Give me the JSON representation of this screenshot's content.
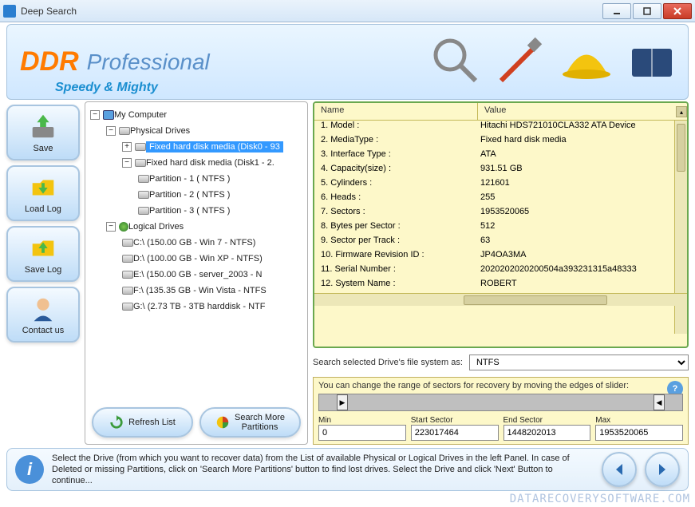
{
  "window": {
    "title": "Deep Search"
  },
  "banner": {
    "brand": "DDR",
    "suffix": "Professional",
    "tagline": "Speedy & Mighty"
  },
  "sidebar": [
    {
      "label": "Save"
    },
    {
      "label": "Load Log"
    },
    {
      "label": "Save Log"
    },
    {
      "label": "Contact us"
    }
  ],
  "tree": {
    "root": "My Computer",
    "physical": "Physical Drives",
    "disk0": "Fixed hard disk media (Disk0 - 93",
    "disk1": "Fixed hard disk media (Disk1 - 2.",
    "part1": "Partition - 1 ( NTFS )",
    "part2": "Partition - 2 ( NTFS )",
    "part3": "Partition - 3 ( NTFS )",
    "logical": "Logical Drives",
    "c": "C:\\ (150.00 GB - Win 7 - NTFS)",
    "d": "D:\\ (100.00 GB - Win XP - NTFS)",
    "e": "E:\\ (150.00 GB - server_2003 - N",
    "f": "F:\\ (135.35 GB - Win Vista - NTFS",
    "g": "G:\\ (2.73 TB - 3TB harddisk - NTF"
  },
  "tree_buttons": {
    "refresh": "Refresh List",
    "more": "Search More\nPartitions"
  },
  "props": {
    "header_name": "Name",
    "header_value": "Value",
    "rows": [
      {
        "name": "1. Model :",
        "value": "Hitachi HDS721010CLA332 ATA Device"
      },
      {
        "name": "2. MediaType :",
        "value": "Fixed hard disk media"
      },
      {
        "name": "3. Interface Type :",
        "value": "ATA"
      },
      {
        "name": "4. Capacity(size) :",
        "value": "931.51 GB"
      },
      {
        "name": "5. Cylinders :",
        "value": "121601"
      },
      {
        "name": "6. Heads :",
        "value": "255"
      },
      {
        "name": "7. Sectors :",
        "value": "1953520065"
      },
      {
        "name": "8. Bytes per Sector :",
        "value": "512"
      },
      {
        "name": "9. Sector per Track :",
        "value": "63"
      },
      {
        "name": "10. Firmware Revision ID :",
        "value": "JP4OA3MA"
      },
      {
        "name": "11. Serial Number :",
        "value": "2020202020200504a393231315a48333"
      },
      {
        "name": "12. System Name :",
        "value": "ROBERT"
      }
    ]
  },
  "search": {
    "label": "Search selected Drive's file system as:",
    "value": "NTFS"
  },
  "slider": {
    "msg": "You can change the range of sectors for recovery by moving the edges of slider:",
    "min_label": "Min",
    "start_label": "Start Sector",
    "end_label": "End Sector",
    "max_label": "Max",
    "min": "0",
    "start": "223017464",
    "end": "1448202013",
    "max": "1953520065"
  },
  "footer": {
    "msg": "Select the Drive (from which you want to recover data) from the List of available Physical or Logical Drives in the left Panel. In case of Deleted or missing Partitions, click on 'Search More Partitions' button to find lost drives. Select the Drive and click 'Next' Button to continue..."
  },
  "watermark": "DATARECOVERYSOFTWARE.COM"
}
